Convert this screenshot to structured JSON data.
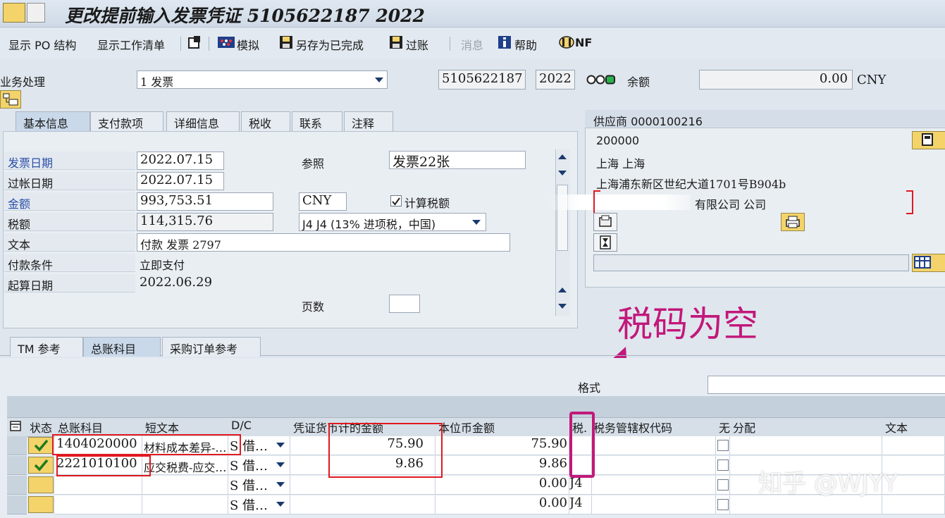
{
  "window": {
    "title": "更改提前输入发票凭证 5105622187 2022"
  },
  "toolbar": {
    "show_po": "显示 PO 结构",
    "worklist": "显示工作清单",
    "simulate": "模拟",
    "save_complete": "另存为已完成",
    "post": "过账",
    "messages": "消息",
    "help": "帮助",
    "nf": "NF"
  },
  "header": {
    "transaction_label": "业务处理",
    "transaction_value": "1 发票",
    "doc_number": "5105622187",
    "year": "2022",
    "balance_label": "余额",
    "balance_value": "0.00",
    "balance_currency": "CNY"
  },
  "tabs": [
    "基本信息",
    "支付款项",
    "详细信息",
    "税收",
    "联系",
    "注释"
  ],
  "basic": {
    "invoice_date_label": "发票日期",
    "invoice_date": "2022.07.15",
    "posting_date_label": "过帐日期",
    "posting_date": "2022.07.15",
    "amount_label": "金额",
    "amount": "993,753.51",
    "currency": "CNY",
    "calc_tax_label": "计算税额",
    "tax_label": "税额",
    "tax_amount": "114,315.76",
    "tax_code": "J4 J4 (13% 进项税，中国)",
    "text_label": "文本",
    "text_value": "付款 发票 2797",
    "payment_terms_label": "付款条件",
    "payment_terms": "立即支付",
    "baseline_date_label": "起算日期",
    "baseline_date": "2022.06.29",
    "reference_label": "参照",
    "reference_value": "发票22张",
    "pages_label": "页数"
  },
  "vendor": {
    "header": "供应商 0000100216",
    "postcode": "200000",
    "city": "上海  上海",
    "address": "上海浦东新区世纪大道1701号B904b",
    "name": "有限公司 公司"
  },
  "annotation": {
    "text": "税码为空"
  },
  "lower_tabs": [
    "TM 参考",
    "总账科目",
    "采购订单参考"
  ],
  "layout_label": "格式",
  "grid": {
    "columns": [
      "状态",
      "总账科目",
      "短文本",
      "D/C",
      "凭证货币计的金额",
      "本位币金额",
      "税.",
      "税务管辖权代码",
      "无",
      "分配",
      "文本"
    ],
    "rows": [
      {
        "account": "1404020000",
        "short_text": "材料成本差异-…",
        "dc": "S 借…",
        "amount": "75.90",
        "local_amount": "75.90",
        "tax": ""
      },
      {
        "account": "2221010100",
        "short_text": "应交税费-应交…",
        "dc": "S 借…",
        "amount": "9.86",
        "local_amount": "9.86",
        "tax": ""
      },
      {
        "account": "",
        "short_text": "",
        "dc": "S 借…",
        "amount": "",
        "local_amount": "0.00",
        "tax": "J4"
      },
      {
        "account": "",
        "short_text": "",
        "dc": "S 借…",
        "amount": "",
        "local_amount": "0.00",
        "tax": "J4"
      }
    ]
  },
  "watermark": "知乎 @WJYY"
}
